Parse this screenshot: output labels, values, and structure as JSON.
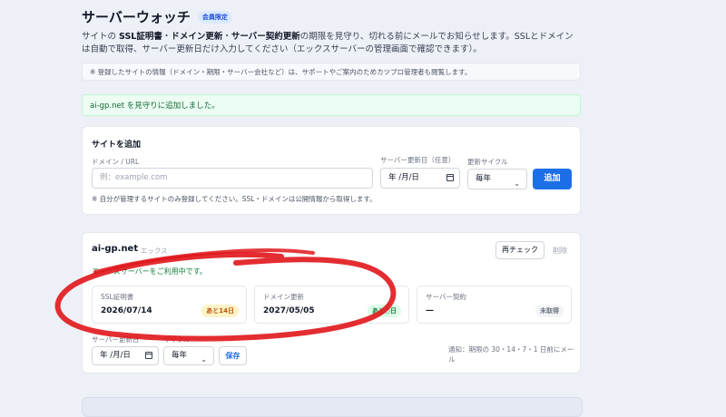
{
  "header": {
    "title": "サーバーウォッチ",
    "badge": "会員限定",
    "desc_1": "サイトの ",
    "desc_ssl": "SSL証明書",
    "desc_sep1": "・",
    "desc_domain": "ドメイン更新",
    "desc_sep2": "・",
    "desc_server": "サーバー契約更新",
    "desc_2": "の期限を見守り、切れる前にメールでお知らせします。SSLとドメインは自動で取得、サーバー更新日だけ入力してください（エックスサーバーの管理画面で確認できます）。"
  },
  "note": "※ 登録したサイトの情報（ドメイン・期限・サーバー会社など）は、サポートやご案内のためカツプロ管理者も閲覧します。",
  "success_message": "ai-gp.net を見守りに追加しました。",
  "add_site": {
    "title": "サイトを追加",
    "domain_label": "ドメイン / URL",
    "domain_placeholder": "例：example.com",
    "date_label": "サーバー更新日（任意）",
    "date_value": "年 /月/日",
    "cycle_label": "更新サイクル",
    "cycle_value": "毎年",
    "submit_label": "追加",
    "footnote": "※ 自分が管理するサイトのみ登録してください。SSL・ドメインは公開情報から取得します。"
  },
  "site": {
    "name": "ai-gp.net",
    "tag": "エックス",
    "recheck_label": "再チェック",
    "delete_label": "削除",
    "server_message": "エックスサーバーをご利用中です。",
    "ssl": {
      "label": "SSL証明書",
      "date": "2026/07/14",
      "badge": "あと14日"
    },
    "domain": {
      "label": "ドメイン更新",
      "date": "2027/05/05",
      "badge": "あと○日"
    },
    "server": {
      "label": "サーバー契約",
      "date": "—",
      "badge": "未取得"
    },
    "update_label": "サーバー更新日",
    "update_value": "年 /月/日",
    "cycle_label": "サイクル",
    "cycle_value": "毎年",
    "save_label": "保存",
    "notice": "通知：期限の 30・14・7・1 日前にメール"
  },
  "colors": {
    "accent": "#1d6fe8",
    "success_bg": "#ecfdf3",
    "marker": "#e0161b"
  }
}
